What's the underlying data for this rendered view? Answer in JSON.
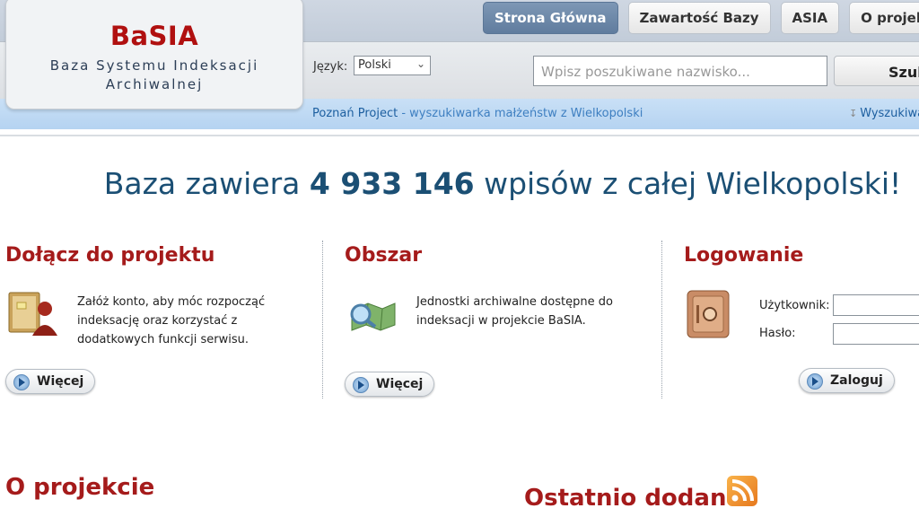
{
  "logo": {
    "title": "BaSIA",
    "subtitle": "Baza Systemu Indeksacji Archiwalnej"
  },
  "nav": {
    "items": [
      {
        "label": "Strona Główna",
        "active": true
      },
      {
        "label": "Zawartość Bazy",
        "active": false
      },
      {
        "label": "ASIA",
        "active": false
      },
      {
        "label": "O projekcie",
        "active": false
      }
    ]
  },
  "search": {
    "language_label": "Język:",
    "language_value": "Polski",
    "placeholder": "Wpisz poszukiwane nazwisko...",
    "button_label": "Szukaj"
  },
  "infobar": {
    "link_name": "Poznań Project",
    "link_desc": " - wyszukiwarka małżeństw z Wielkopolski",
    "right_link": "Wyszukiwanie"
  },
  "headline": {
    "prefix": "Baza zawiera ",
    "count": "4 933 146",
    "suffix": " wpisów z całej Wielkopolski!"
  },
  "columns": {
    "join": {
      "title": "Dołącz do projektu",
      "text": "Załóż konto, aby móc rozpocząć indeksację oraz korzystać z dodatkowych funkcji serwisu.",
      "button": "Więcej"
    },
    "area": {
      "title": "Obszar",
      "text": "Jednostki archiwalne dostępne do indeksacji w projekcie BaSIA.",
      "button": "Więcej"
    },
    "login": {
      "title": "Logowanie",
      "user_label": "Użytkownik:",
      "pass_label": "Hasło:",
      "button": "Zaloguj"
    }
  },
  "sections": {
    "about_title": "O projekcie",
    "recent_title": "Ostatnio dodane"
  },
  "colors": {
    "brand_red": "#a51b1b",
    "headline_blue": "#1b4f74",
    "nav_active": "#6f89aa"
  }
}
